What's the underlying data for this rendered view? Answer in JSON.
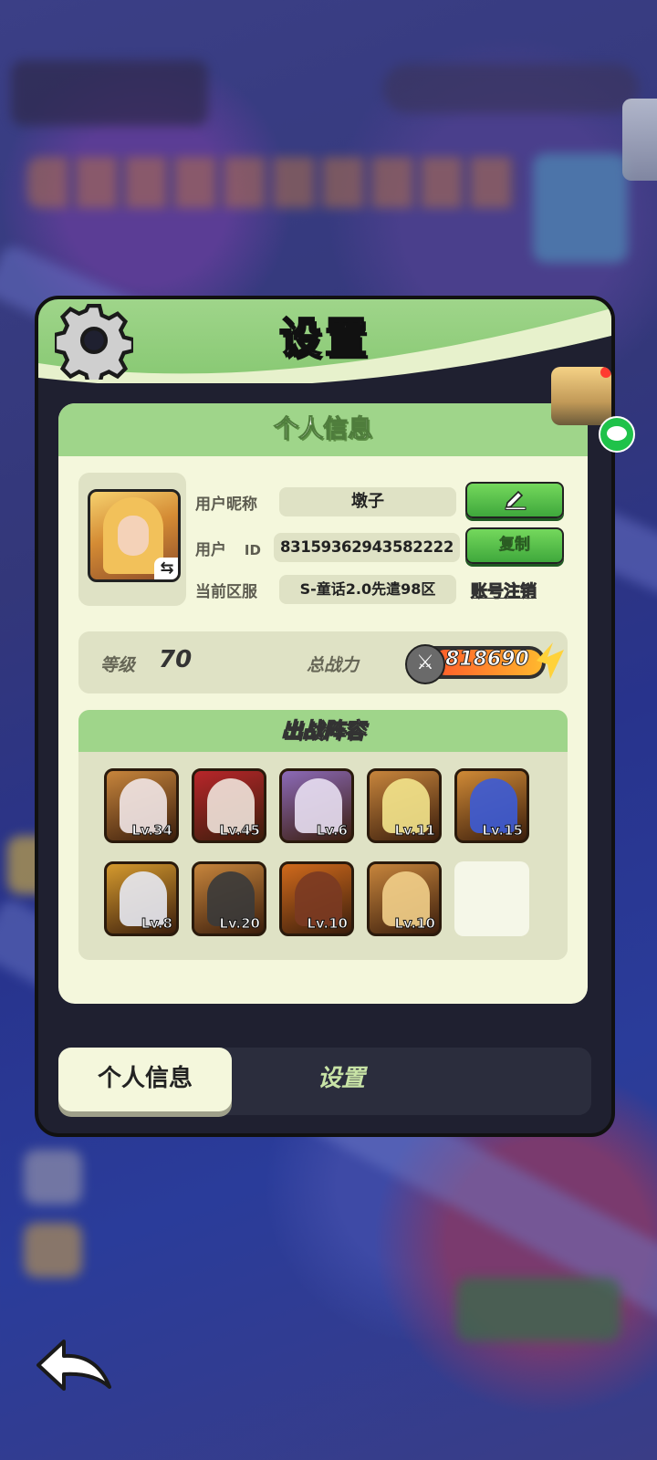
{
  "app": {
    "title": "设置"
  },
  "personal_info": {
    "section_title": "个人信息",
    "nickname_label": "用户昵称",
    "nickname": "墩子",
    "uid_label": "用户",
    "uid_label_suffix": "ID",
    "uid": "83159362943582222",
    "server_label": "当前区服",
    "server": "S-童话2.0先遣98区",
    "copy_button": "复制",
    "delete_account_link": "账号注销",
    "edit_icon": "pencil-icon",
    "avatar_swap_glyph": "⇆"
  },
  "stats": {
    "level_label": "等级",
    "level": "70",
    "power_label": "总战力",
    "power": "818690"
  },
  "lineup": {
    "title": "出战阵容",
    "heroes": [
      {
        "level": "Lv.34",
        "bg": "#c7853c",
        "tint": "#f1e6e6"
      },
      {
        "level": "Lv.45",
        "bg": "#b8262a",
        "tint": "#f0e3da"
      },
      {
        "level": "Lv.6",
        "bg": "#8c6ab8",
        "tint": "#e8dff2"
      },
      {
        "level": "Lv.11",
        "bg": "#c7853c",
        "tint": "#f3e48c"
      },
      {
        "level": "Lv.15",
        "bg": "#d08a36",
        "tint": "#3c5bd6"
      },
      {
        "level": "Lv.8",
        "bg": "#d59a2e",
        "tint": "#e7e9f2"
      },
      {
        "level": "Lv.20",
        "bg": "#c7853c",
        "tint": "#3a3a3a"
      },
      {
        "level": "Lv.10",
        "bg": "#d06a1c",
        "tint": "#7a3a22"
      },
      {
        "level": "Lv.10",
        "bg": "#c7853c",
        "tint": "#f2cf8a"
      }
    ]
  },
  "tabs": [
    {
      "label": "个人信息",
      "active": true
    },
    {
      "label": "设置",
      "active": false
    }
  ],
  "colors": {
    "accent_green": "#9fd58a",
    "button_green": "#3fa83c",
    "panel_dark": "#1f2030",
    "card_bg": "#f4f7dc"
  }
}
